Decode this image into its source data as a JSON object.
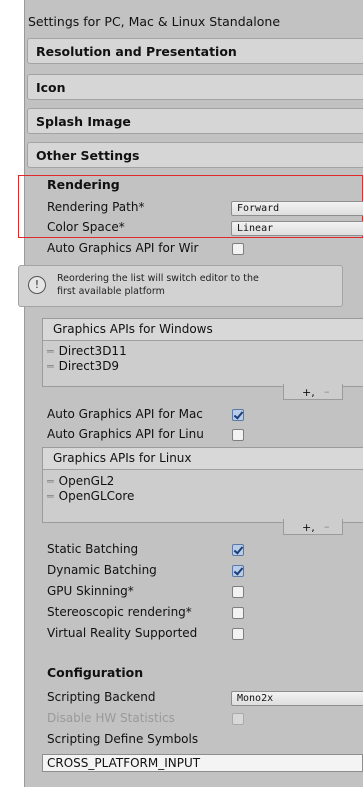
{
  "header": {
    "title": "Settings for PC, Mac & Linux Standalone"
  },
  "sections": {
    "resolution": "Resolution and Presentation",
    "icon": "Icon",
    "splash": "Splash Image",
    "other": "Other Settings"
  },
  "rendering": {
    "heading": "Rendering",
    "path_label": "Rendering Path*",
    "path_value": "Forward",
    "color_label": "Color Space*",
    "color_value": "Linear"
  },
  "auto_api_windows": {
    "label": "Auto Graphics API for Wir",
    "checked": false
  },
  "info": {
    "line1": "Reordering the list will switch editor to the",
    "line2": "first available platform"
  },
  "windows_apis": {
    "header": "Graphics APIs for Windows",
    "items": [
      "Direct3D11",
      "Direct3D9"
    ]
  },
  "auto_api_mac": {
    "label": "Auto Graphics API for Mac",
    "checked": true
  },
  "auto_api_linux": {
    "label": "Auto Graphics API for Linu",
    "checked": false
  },
  "linux_apis": {
    "header": "Graphics APIs for Linux",
    "items": [
      "OpenGL2",
      "OpenGLCore"
    ]
  },
  "list_controls": {
    "add": "+,",
    "remove": "–"
  },
  "options": [
    {
      "label": "Static Batching",
      "checked": true
    },
    {
      "label": "Dynamic Batching",
      "checked": true
    },
    {
      "label": "GPU Skinning*",
      "checked": false
    },
    {
      "label": "Stereoscopic rendering*",
      "checked": false
    },
    {
      "label": "Virtual Reality Supported",
      "checked": false
    }
  ],
  "configuration": {
    "heading": "Configuration",
    "backend_label": "Scripting Backend",
    "backend_value": "Mono2x",
    "hw_stats_label": "Disable HW Statistics",
    "define_label": "Scripting Define Symbols",
    "define_value": "CROSS_PLATFORM_INPUT"
  },
  "icons": {
    "dropdown": "dropdown-arrow-icon",
    "info": "info-icon",
    "grip": "drag-handle-icon",
    "check": "checkmark-icon"
  }
}
